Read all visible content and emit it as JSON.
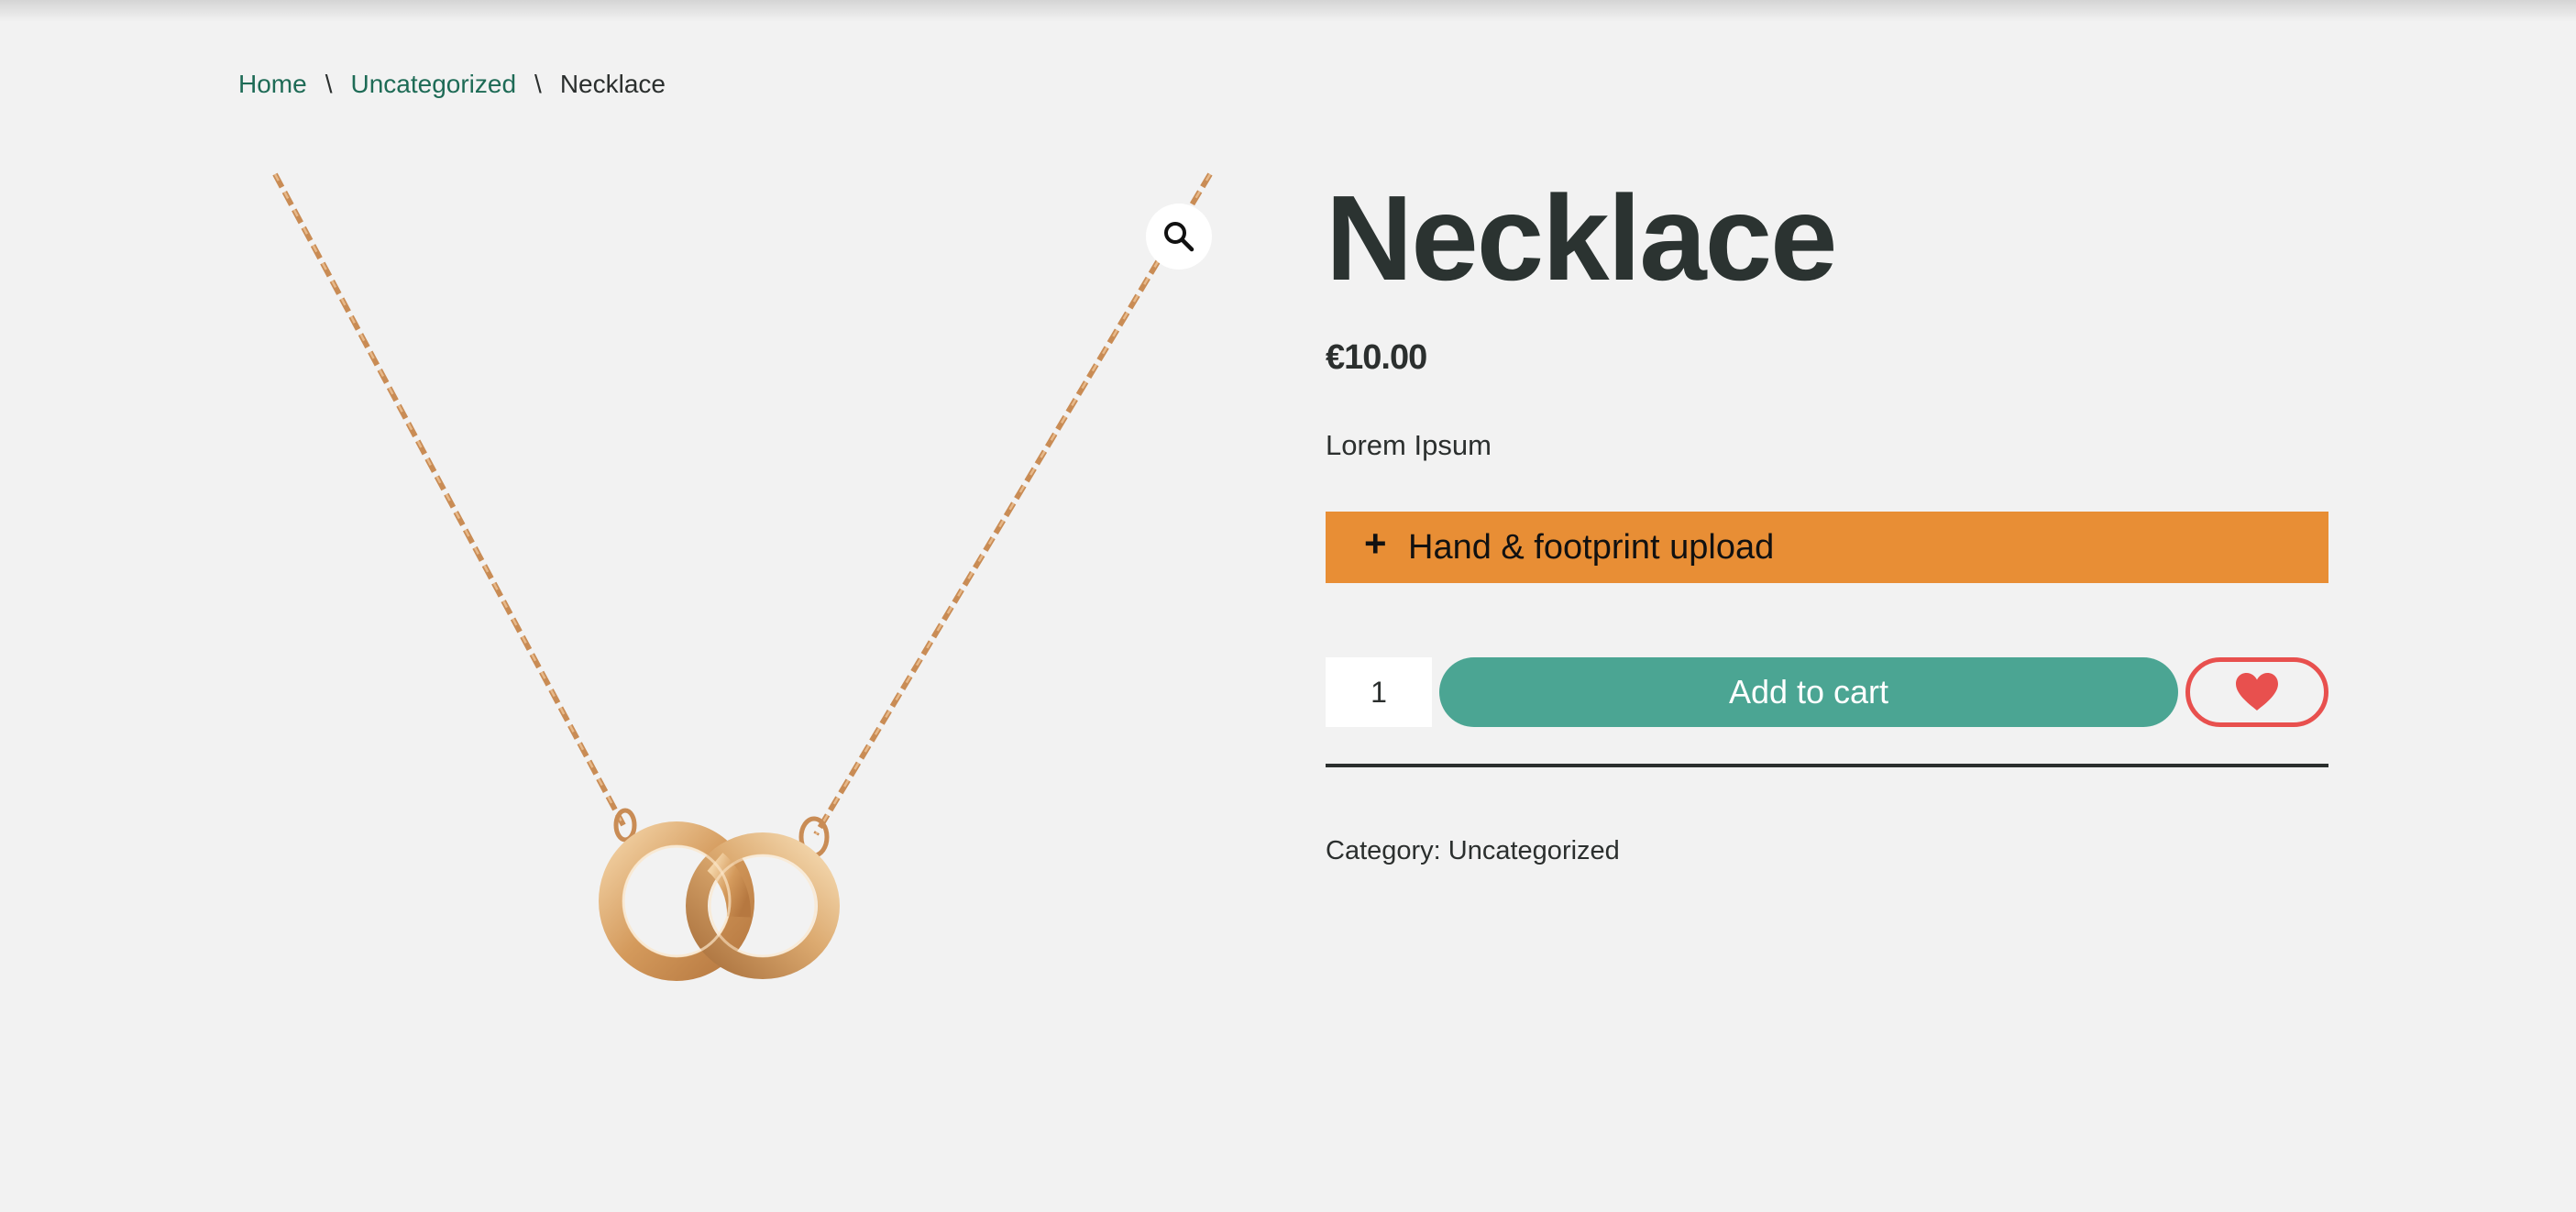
{
  "breadcrumb": {
    "items": [
      {
        "label": "Home"
      },
      {
        "label": "Uncategorized"
      }
    ],
    "separator": "\\",
    "current": "Necklace"
  },
  "gallery": {
    "image_icon": "necklace-image",
    "zoom_icon": "search-icon"
  },
  "product": {
    "title": "Necklace",
    "price": "€10.00",
    "short_description": "Lorem Ipsum",
    "addon": {
      "icon": "plus-icon",
      "plus_symbol": "+",
      "label": "Hand & footprint upload"
    },
    "quantity": "1",
    "add_to_cart_label": "Add to cart",
    "wishlist_icon": "heart-icon",
    "category_label": "Category:",
    "category_value": "Uncategorized"
  },
  "colors": {
    "background": "#f2f2f2",
    "link": "#1e6b56",
    "addon_bar": "#e88e35",
    "add_to_cart": "#4ba593",
    "wishlist": "#e8504e",
    "title": "#2b3331"
  }
}
